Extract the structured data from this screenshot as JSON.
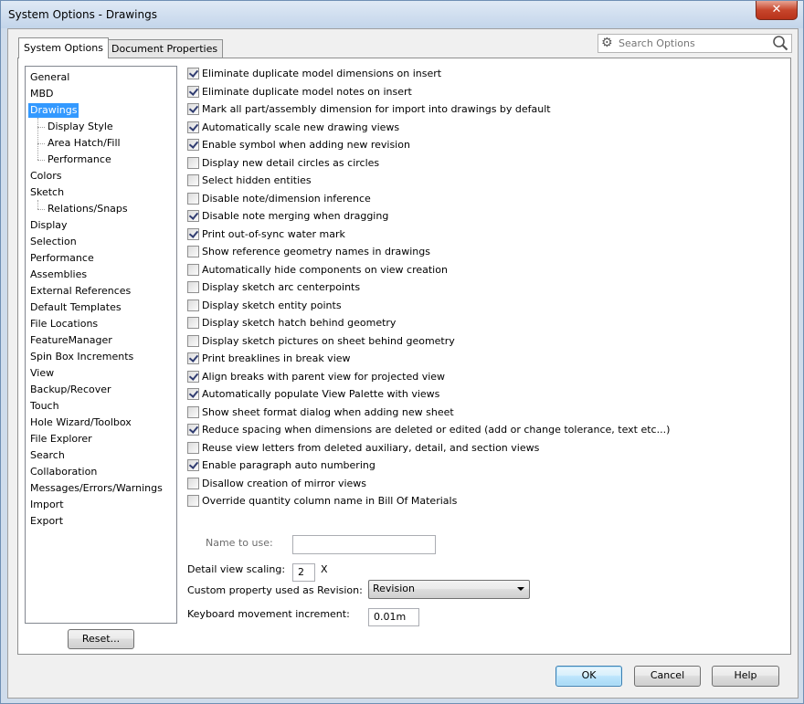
{
  "window": {
    "title": "System Options - Drawings",
    "close_label": "✕"
  },
  "tabs": [
    {
      "label": "System Options",
      "active": true
    },
    {
      "label": "Document Properties",
      "active": false
    }
  ],
  "search": {
    "placeholder": "Search Options",
    "icon_left": "gear-icon",
    "icon_right": "magnifier-icon"
  },
  "tree": [
    {
      "label": "General",
      "level": 0
    },
    {
      "label": "MBD",
      "level": 0
    },
    {
      "label": "Drawings",
      "level": 0,
      "selected": true
    },
    {
      "label": "Display Style",
      "level": 1
    },
    {
      "label": "Area Hatch/Fill",
      "level": 1
    },
    {
      "label": "Performance",
      "level": 1
    },
    {
      "label": "Colors",
      "level": 0
    },
    {
      "label": "Sketch",
      "level": 0
    },
    {
      "label": "Relations/Snaps",
      "level": 1
    },
    {
      "label": "Display",
      "level": 0
    },
    {
      "label": "Selection",
      "level": 0
    },
    {
      "label": "Performance",
      "level": 0
    },
    {
      "label": "Assemblies",
      "level": 0
    },
    {
      "label": "External References",
      "level": 0
    },
    {
      "label": "Default Templates",
      "level": 0
    },
    {
      "label": "File Locations",
      "level": 0
    },
    {
      "label": "FeatureManager",
      "level": 0
    },
    {
      "label": "Spin Box Increments",
      "level": 0
    },
    {
      "label": "View",
      "level": 0
    },
    {
      "label": "Backup/Recover",
      "level": 0
    },
    {
      "label": "Touch",
      "level": 0
    },
    {
      "label": "Hole Wizard/Toolbox",
      "level": 0
    },
    {
      "label": "File Explorer",
      "level": 0
    },
    {
      "label": "Search",
      "level": 0
    },
    {
      "label": "Collaboration",
      "level": 0
    },
    {
      "label": "Messages/Errors/Warnings",
      "level": 0
    },
    {
      "label": "Import",
      "level": 0
    },
    {
      "label": "Export",
      "level": 0
    }
  ],
  "reset_label": "Reset...",
  "options": [
    {
      "label": "Eliminate duplicate model dimensions on insert",
      "checked": true
    },
    {
      "label": "Eliminate duplicate model notes on insert",
      "checked": true
    },
    {
      "label": "Mark all part/assembly dimension for import into drawings by default",
      "checked": true
    },
    {
      "label": "Automatically scale new drawing views",
      "checked": true
    },
    {
      "label": "Enable symbol when adding new revision",
      "checked": true
    },
    {
      "label": "Display new detail circles as circles",
      "checked": false
    },
    {
      "label": "Select hidden entities",
      "checked": false
    },
    {
      "label": "Disable note/dimension inference",
      "checked": false
    },
    {
      "label": "Disable note merging when dragging",
      "checked": true
    },
    {
      "label": "Print out-of-sync water mark",
      "checked": true
    },
    {
      "label": "Show reference geometry names in drawings",
      "checked": false
    },
    {
      "label": "Automatically hide components on view creation",
      "checked": false
    },
    {
      "label": "Display sketch arc centerpoints",
      "checked": false
    },
    {
      "label": "Display sketch entity points",
      "checked": false
    },
    {
      "label": "Display sketch hatch behind geometry",
      "checked": false
    },
    {
      "label": "Display sketch pictures on sheet behind geometry",
      "checked": false
    },
    {
      "label": "Print breaklines in break view",
      "checked": true
    },
    {
      "label": "Align breaks with parent view for projected view",
      "checked": true
    },
    {
      "label": "Automatically populate View Palette with views",
      "checked": true
    },
    {
      "label": "Show sheet format dialog when adding new sheet",
      "checked": false
    },
    {
      "label": "Reduce spacing when dimensions are deleted or edited (add or change tolerance, text etc...)",
      "checked": true
    },
    {
      "label": "Reuse view letters from deleted auxiliary, detail, and section views",
      "checked": false
    },
    {
      "label": "Enable paragraph auto numbering",
      "checked": true
    },
    {
      "label": "Disallow creation of mirror views",
      "checked": false
    },
    {
      "label": "Override quantity column name in Bill Of Materials",
      "checked": false
    }
  ],
  "name_to_use": {
    "label": "Name to use:",
    "value": ""
  },
  "detail_scaling": {
    "label": "Detail view scaling:",
    "value": "2",
    "unit": "X"
  },
  "custom_property": {
    "label": "Custom property used as Revision:",
    "value": "Revision"
  },
  "keyboard_increment": {
    "label": "Keyboard movement increment:",
    "value": "0.01m"
  },
  "buttons": {
    "ok": "OK",
    "cancel": "Cancel",
    "help": "Help"
  }
}
